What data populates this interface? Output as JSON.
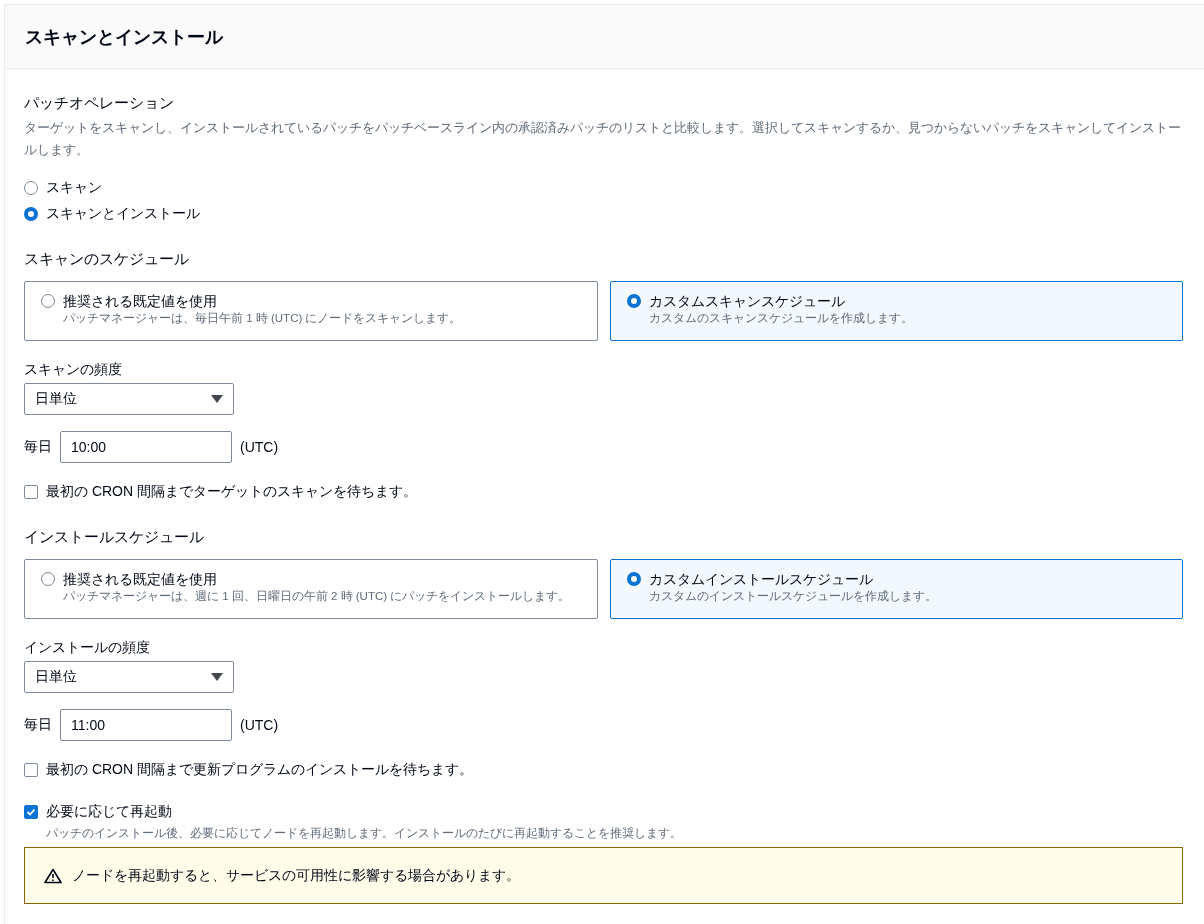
{
  "panel": {
    "title": "スキャンとインストール"
  },
  "operation": {
    "label": "パッチオペレーション",
    "description": "ターゲットをスキャンし、インストールされているパッチをパッチベースライン内の承認済みパッチのリストと比較します。選択してスキャンするか、見つからないパッチをスキャンしてインストールします。",
    "options": [
      {
        "label": "スキャン",
        "selected": false
      },
      {
        "label": "スキャンとインストール",
        "selected": true
      }
    ]
  },
  "schedules": [
    {
      "label": "スキャンのスケジュール",
      "cards": [
        {
          "title": "推奨される既定値を使用",
          "description": "パッチマネージャーは、毎日午前 1 時 (UTC) にノードをスキャンします。",
          "selected": false
        },
        {
          "title": "カスタムスキャンスケジュール",
          "description": "カスタムのスキャンスケジュールを作成します。",
          "selected": true
        }
      ],
      "frequency": {
        "label": "スキャンの頻度",
        "value": "日単位"
      },
      "time": {
        "label": "毎日",
        "value": "10:00",
        "suffix": "(UTC)"
      },
      "wait": {
        "label": "最初の CRON 間隔までターゲットのスキャンを待ちます。",
        "checked": false
      }
    },
    {
      "label": "インストールスケジュール",
      "cards": [
        {
          "title": "推奨される既定値を使用",
          "description": "パッチマネージャーは、週に 1 回、日曜日の午前 2 時 (UTC) にパッチをインストールします。",
          "selected": false
        },
        {
          "title": "カスタムインストールスケジュール",
          "description": "カスタムのインストールスケジュールを作成します。",
          "selected": true
        }
      ],
      "frequency": {
        "label": "インストールの頻度",
        "value": "日単位"
      },
      "time": {
        "label": "毎日",
        "value": "11:00",
        "suffix": "(UTC)"
      },
      "wait": {
        "label": "最初の CRON 間隔まで更新プログラムのインストールを待ちます。",
        "checked": false
      }
    }
  ],
  "reboot": {
    "label": "必要に応じて再起動",
    "description": "パッチのインストール後、必要に応じてノードを再起動します。インストールのたびに再起動することを推奨します。",
    "checked": true
  },
  "warning": {
    "text": "ノードを再起動すると、サービスの可用性に影響する場合があります。"
  }
}
